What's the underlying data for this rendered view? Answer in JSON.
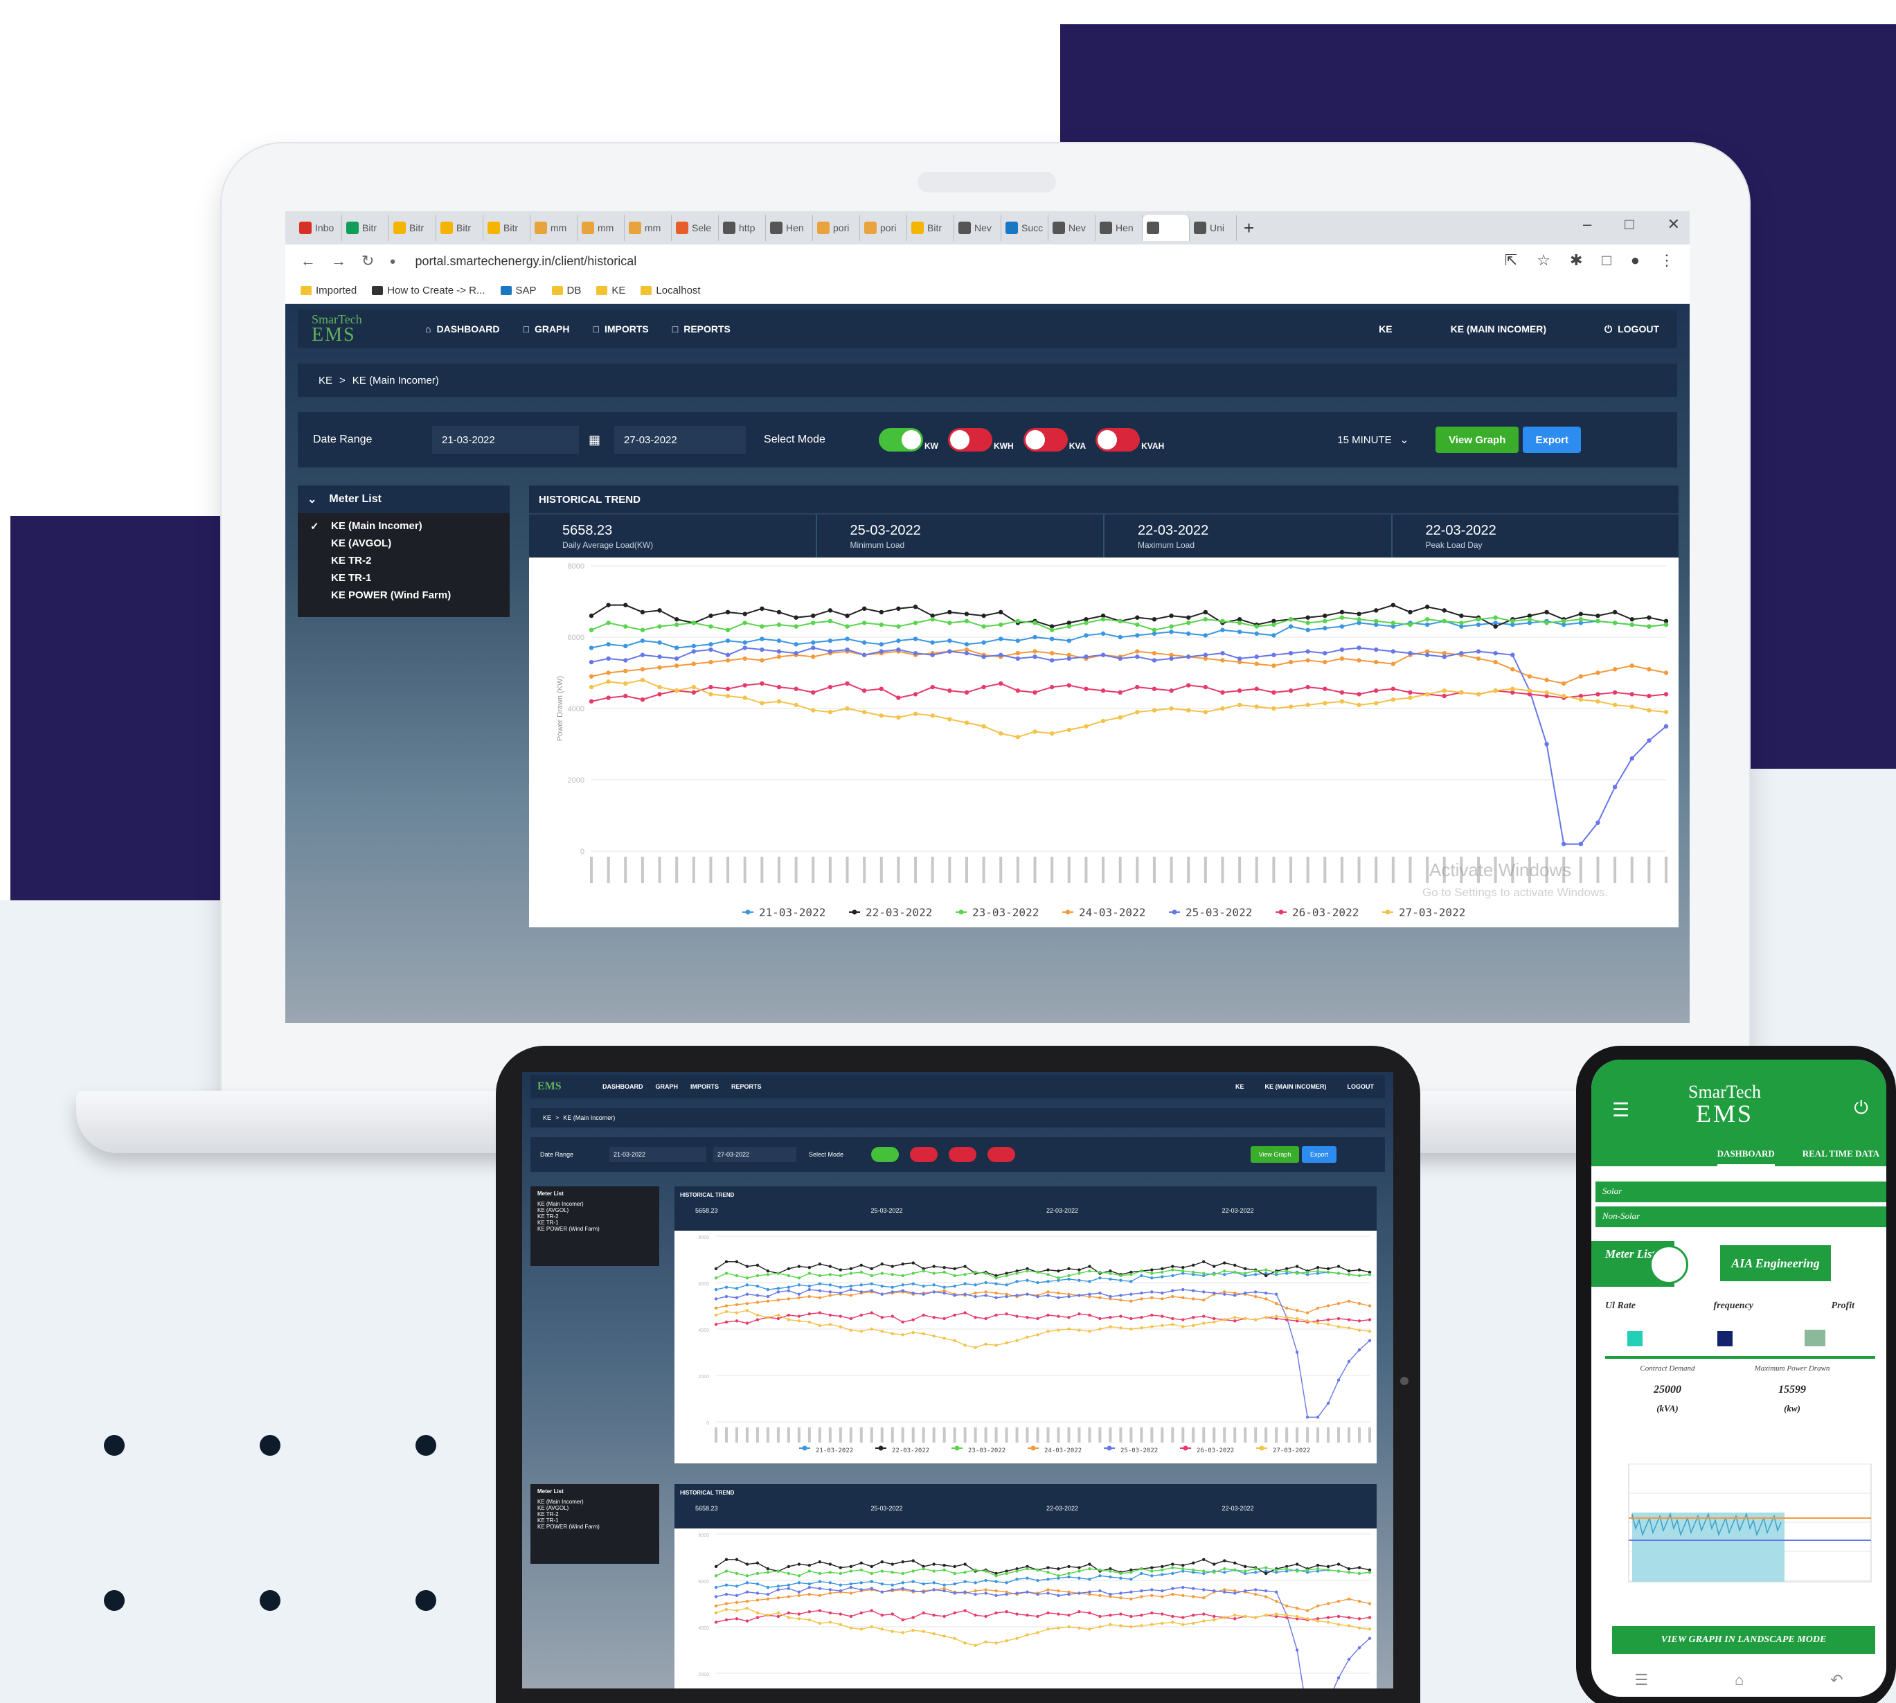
{
  "browser": {
    "tabs": [
      "Inbo",
      "Bitr",
      "Bitr",
      "Bitr",
      "Bitr",
      "mm",
      "mm",
      "mm",
      "Sele",
      "http",
      "Hen",
      "pori",
      "pori",
      "Bitr",
      "Nev",
      "Succ",
      "Nev",
      "Hen",
      "",
      "Uni"
    ],
    "url": "portal.smartechenergy.in/client/historical",
    "bookmarks": [
      "Imported",
      "How to Create -> R...",
      "SAP",
      "DB",
      "KE",
      "Localhost"
    ]
  },
  "app": {
    "logo_line1": "SmarTech",
    "logo_line2": "EMS",
    "nav": {
      "dashboard": "DASHBOARD",
      "graph": "GRAPH",
      "imports": "IMPORTS",
      "reports": "REPORTS",
      "ke": "KE",
      "ke_main": "KE (MAIN INCOMER)",
      "logout": "LOGOUT"
    },
    "breadcrumb": {
      "root": "KE",
      "sep": ">",
      "current": "KE (Main Incomer)"
    },
    "filters": {
      "date_range_label": "Date Range",
      "date_from": "21-03-2022",
      "date_to": "27-03-2022",
      "select_mode_label": "Select Mode",
      "modes": [
        {
          "label": "KW",
          "on": true
        },
        {
          "label": "KWH",
          "on": false
        },
        {
          "label": "KVA",
          "on": false
        },
        {
          "label": "KVAH",
          "on": false
        }
      ],
      "interval": "15 MINUTE",
      "view_graph": "View Graph",
      "export": "Export"
    },
    "meter_list": {
      "title": "Meter List",
      "items": [
        "KE (Main Incomer)",
        "KE (AVGOL)",
        "KE TR-2",
        "KE TR-1",
        "KE POWER (Wind Farm)"
      ]
    },
    "trend": {
      "title": "HISTORICAL TREND",
      "stats": [
        {
          "value": "5658.23",
          "label": "Daily Average Load(KW)"
        },
        {
          "value": "25-03-2022",
          "label": "Minimum Load"
        },
        {
          "value": "22-03-2022",
          "label": "Maximum Load"
        },
        {
          "value": "22-03-2022",
          "label": "Peak Load Day"
        }
      ]
    },
    "watermark": {
      "line1": "Activate Windows",
      "line2": "Go to Settings to activate Windows."
    }
  },
  "phone": {
    "logo_line1": "SmarTech",
    "logo_line2": "EMS",
    "tabs": [
      "DASHBOARD",
      "REAL TIME DATA"
    ],
    "rows": [
      "Solar",
      "Non-Solar"
    ],
    "meter_list": "Meter List",
    "company": "AIA Engineering",
    "indicators": [
      "Ul Rate",
      "frequency",
      "Profit"
    ],
    "contract_demand_label": "Contract Demand",
    "contract_demand_value": "25000",
    "contract_demand_unit": "(kVA)",
    "max_power_label": "Maximum Power Drawn",
    "max_power_value": "15599",
    "max_power_unit": "(kw)",
    "view_button": "VIEW GRAPH IN LANDSCAPE MODE"
  },
  "colors": {
    "navy": "#251c5a",
    "app_dark": "#1a2e49",
    "green": "#3aae2a",
    "blue_btn": "#2d8cf0",
    "toggle_on": "#44c03a",
    "toggle_off": "#d9263a",
    "phone_green": "#1f9d3f"
  },
  "chart_data": {
    "type": "line",
    "ylabel": "Power Drawn (KW)",
    "ylim": [
      0,
      8000
    ],
    "yticks": [
      0,
      2000,
      4000,
      6000,
      8000
    ],
    "grid": true,
    "legend_position": "bottom",
    "series": [
      {
        "name": "21-03-2022",
        "color": "#3a96e0",
        "values": [
          5700,
          5800,
          5750,
          5900,
          5850,
          5700,
          5750,
          5800,
          5900,
          5850,
          5950,
          5900,
          5800,
          5850,
          5900,
          5950,
          5850,
          5800,
          5900,
          5950,
          5850,
          5900,
          5800,
          5850,
          5950,
          5900,
          6000,
          5950,
          5900,
          6050,
          6100,
          6000,
          6050,
          6100,
          6150,
          6100,
          6050,
          6200,
          6150,
          6100,
          6050,
          6300,
          6200,
          6250,
          6300,
          6400,
          6350,
          6300,
          6400,
          6350,
          6450,
          6300,
          6350,
          6400,
          6350,
          6400,
          6450,
          6350,
          6400,
          6450,
          6400,
          6350,
          6300,
          6350
        ]
      },
      {
        "name": "22-03-2022",
        "color": "#222222",
        "values": [
          6600,
          6900,
          6900,
          6700,
          6750,
          6500,
          6400,
          6600,
          6700,
          6650,
          6800,
          6700,
          6550,
          6600,
          6750,
          6600,
          6800,
          6700,
          6800,
          6850,
          6600,
          6700,
          6650,
          6600,
          6700,
          6400,
          6450,
          6300,
          6400,
          6500,
          6600,
          6450,
          6550,
          6500,
          6600,
          6550,
          6700,
          6400,
          6500,
          6350,
          6450,
          6500,
          6550,
          6600,
          6700,
          6650,
          6750,
          6900,
          6700,
          6850,
          6750,
          6600,
          6550,
          6300,
          6500,
          6600,
          6700,
          6500,
          6650,
          6600,
          6700,
          6500,
          6550,
          6450
        ]
      },
      {
        "name": "23-03-2022",
        "color": "#59d44d",
        "values": [
          6200,
          6400,
          6300,
          6200,
          6300,
          6350,
          6400,
          6300,
          6200,
          6400,
          6300,
          6350,
          6300,
          6400,
          6450,
          6300,
          6400,
          6350,
          6300,
          6400,
          6500,
          6400,
          6450,
          6300,
          6350,
          6450,
          6400,
          6200,
          6300,
          6400,
          6500,
          6450,
          6350,
          6200,
          6300,
          6400,
          6500,
          6450,
          6400,
          6300,
          6350,
          6500,
          6400,
          6450,
          6550,
          6500,
          6450,
          6400,
          6350,
          6500,
          6450,
          6400,
          6500,
          6550,
          6450,
          6500,
          6400,
          6450,
          6500,
          6450,
          6400,
          6350,
          6300,
          6350
        ]
      },
      {
        "name": "24-03-2022",
        "color": "#f59a3c",
        "values": [
          4900,
          5000,
          5050,
          5100,
          5150,
          5200,
          5250,
          5300,
          5350,
          5400,
          5350,
          5450,
          5500,
          5450,
          5550,
          5600,
          5500,
          5550,
          5600,
          5500,
          5550,
          5600,
          5650,
          5500,
          5450,
          5550,
          5600,
          5550,
          5500,
          5400,
          5500,
          5450,
          5600,
          5550,
          5500,
          5450,
          5400,
          5350,
          5300,
          5250,
          5200,
          5300,
          5350,
          5300,
          5400,
          5350,
          5300,
          5250,
          5500,
          5600,
          5550,
          5500,
          5400,
          5300,
          5100,
          4900,
          4800,
          4700,
          4900,
          5000,
          5100,
          5200,
          5100,
          5000
        ]
      },
      {
        "name": "25-03-2022",
        "color": "#6677e8",
        "values": [
          5300,
          5400,
          5350,
          5500,
          5450,
          5400,
          5600,
          5650,
          5500,
          5700,
          5650,
          5600,
          5550,
          5700,
          5600,
          5650,
          5500,
          5600,
          5650,
          5550,
          5500,
          5600,
          5550,
          5450,
          5500,
          5400,
          5450,
          5350,
          5400,
          5450,
          5500,
          5400,
          5450,
          5350,
          5400,
          5450,
          5500,
          5550,
          5400,
          5450,
          5500,
          5550,
          5600,
          5550,
          5650,
          5700,
          5650,
          5600,
          5550,
          5500,
          5450,
          5550,
          5600,
          5550,
          5500,
          4500,
          3000,
          200,
          200,
          800,
          1800,
          2600,
          3100,
          3500
        ]
      },
      {
        "name": "26-03-2022",
        "color": "#e63a6a",
        "values": [
          4200,
          4300,
          4350,
          4250,
          4400,
          4500,
          4450,
          4600,
          4550,
          4650,
          4700,
          4600,
          4550,
          4450,
          4600,
          4700,
          4500,
          4550,
          4300,
          4400,
          4600,
          4500,
          4450,
          4600,
          4700,
          4500,
          4450,
          4600,
          4650,
          4550,
          4500,
          4450,
          4600,
          4550,
          4500,
          4650,
          4600,
          4450,
          4500,
          4550,
          4450,
          4500,
          4600,
          4550,
          4450,
          4400,
          4500,
          4550,
          4450,
          4400,
          4350,
          4450,
          4400,
          4500,
          4450,
          4400,
          4350,
          4300,
          4350,
          4400,
          4450,
          4400,
          4350,
          4400
        ]
      },
      {
        "name": "27-03-2022",
        "color": "#f3c24a",
        "values": [
          4600,
          4750,
          4700,
          4800,
          4600,
          4500,
          4600,
          4400,
          4350,
          4300,
          4150,
          4200,
          4100,
          3950,
          3900,
          4000,
          3900,
          3800,
          3750,
          3850,
          3800,
          3700,
          3600,
          3500,
          3300,
          3200,
          3350,
          3300,
          3400,
          3500,
          3650,
          3750,
          3900,
          3950,
          4000,
          3950,
          3900,
          4000,
          4100,
          4050,
          4000,
          4050,
          4100,
          4150,
          4200,
          4100,
          4150,
          4250,
          4300,
          4400,
          4500,
          4450,
          4400,
          4500,
          4550,
          4500,
          4450,
          4350,
          4250,
          4200,
          4100,
          4050,
          3950,
          3900
        ]
      }
    ]
  }
}
